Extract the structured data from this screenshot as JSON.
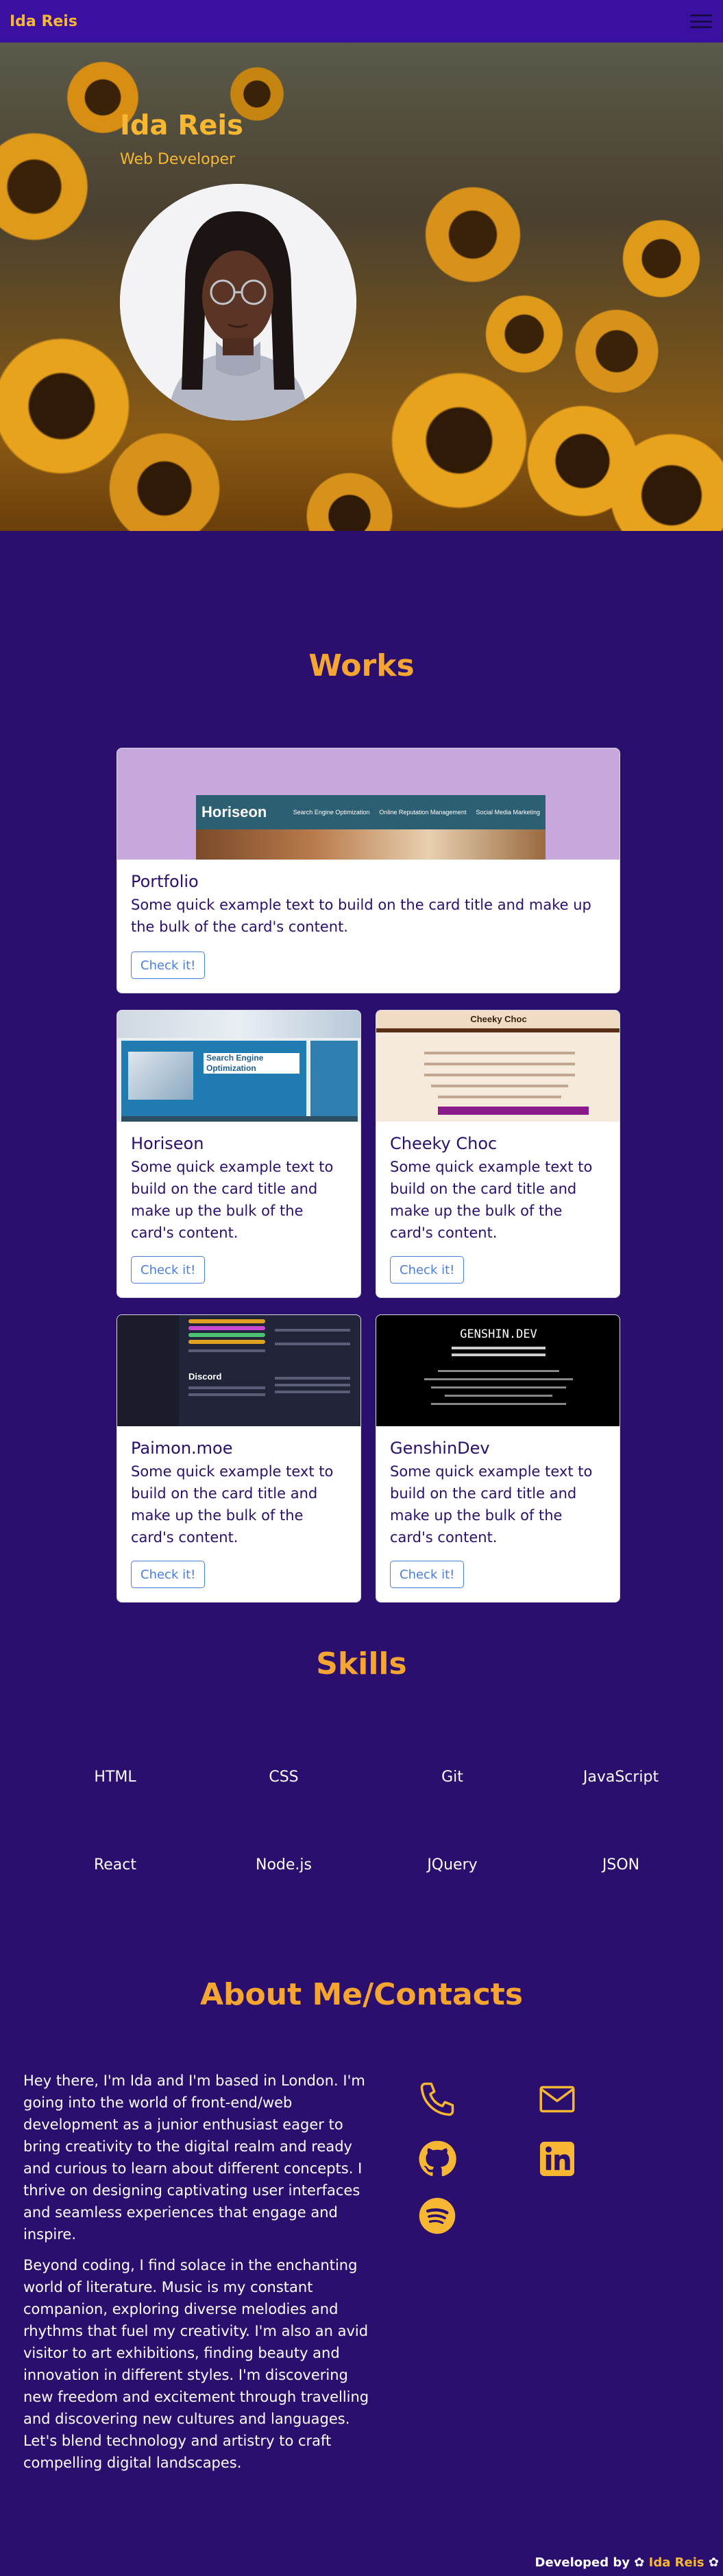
{
  "nav": {
    "brand": "Ida Reis"
  },
  "hero": {
    "name": "Ida Reis",
    "role": "Web Developer"
  },
  "works": {
    "title": "Works",
    "cards": [
      {
        "title": "Portfolio",
        "text": "Some quick example text to build on the card title and make up the bulk of the card's content.",
        "button": "Check it!",
        "preview": {
          "logo": "Horiseon",
          "nav": [
            "Search Engine Optimization",
            "Online Reputation Management",
            "Social Media Marketing"
          ]
        }
      },
      {
        "title": "Horiseon",
        "text": "Some quick example text to build on the card title and make up the bulk of the card's content.",
        "button": "Check it!",
        "preview": {
          "heading": "Search Engine Optimization"
        }
      },
      {
        "title": "Cheeky Choc",
        "text": "Some quick example text to build on the card title and make up the bulk of the card's content.",
        "button": "Check it!",
        "preview": {
          "heading": "Cheeky Choc"
        }
      },
      {
        "title": "Paimon.moe",
        "text": "Some quick example text to build on the card title and make up the bulk of the card's content.",
        "button": "Check it!",
        "preview": {
          "heading": "Discord"
        }
      },
      {
        "title": "GenshinDev",
        "text": "Some quick example text to build on the card title and make up the bulk of the card's content.",
        "button": "Check it!",
        "preview": {
          "heading": "GENSHIN.DEV"
        }
      }
    ]
  },
  "skills": {
    "title": "Skills",
    "items": [
      "HTML",
      "CSS",
      "Git",
      "JavaScript",
      "React",
      "Node.js",
      "JQuery",
      "JSON"
    ]
  },
  "about": {
    "title": "About Me/Contacts",
    "paragraph1": "Hey there, I'm Ida and I'm based in London. I'm going into the world of front-end/web development as a junior enthusiast eager to bring creativity to the digital realm and ready and curious to learn about different concepts. I thrive on designing captivating user interfaces and seamless experiences that engage and inspire.",
    "paragraph2": "Beyond coding, I find solace in the enchanting world of literature. Music is my constant companion, exploring diverse melodies and rhythms that fuel my creativity. I'm also an avid visitor to art exhibitions, finding beauty and innovation in different styles. I'm discovering new freedom and excitement through travelling and discovering new cultures and languages. Let's blend technology and artistry to craft compelling digital landscapes.",
    "contacts": [
      "phone-icon",
      "mail-icon",
      "github-icon",
      "linkedin-icon",
      "spotify-icon"
    ]
  },
  "footer": {
    "prefix": "Developed by",
    "name": "Ida Reis"
  },
  "colors": {
    "background": "#2a0f6f",
    "navbar": "#3a10a0",
    "accent": "#f7b733",
    "heading": "#f7a531",
    "button": "#4a7ddc"
  }
}
